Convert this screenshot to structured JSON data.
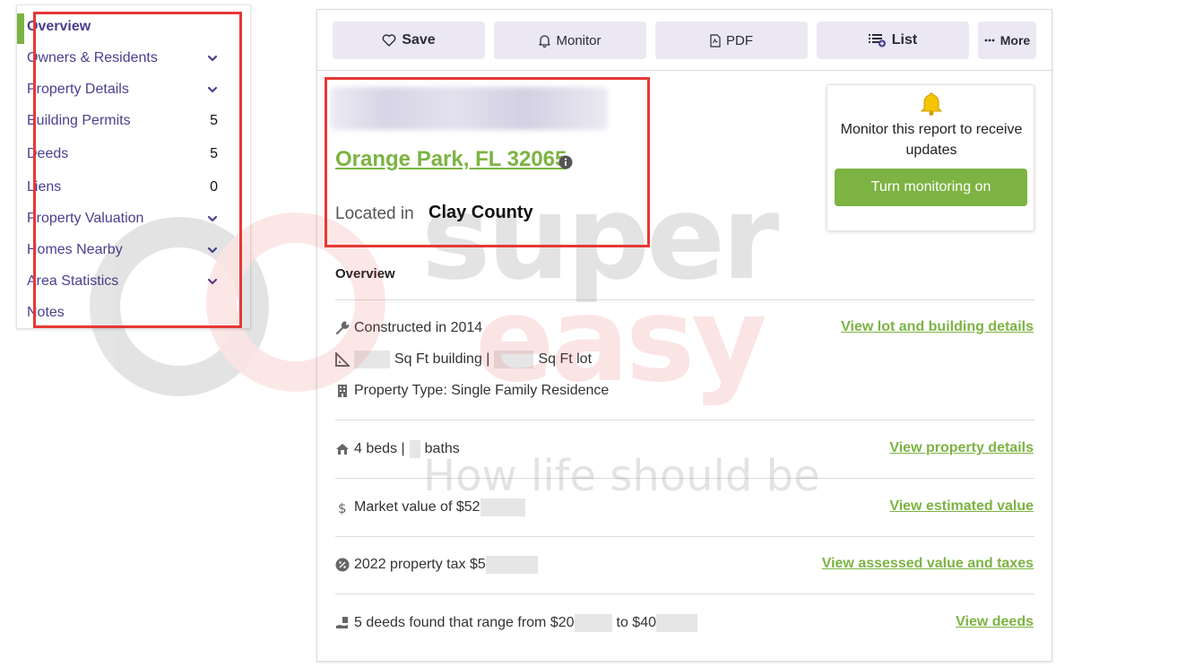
{
  "sidebar": {
    "items": [
      {
        "label": "Overview",
        "active": true
      },
      {
        "label": "Owners & Residents",
        "expandable": true
      },
      {
        "label": "Property Details",
        "expandable": true
      },
      {
        "label": "Building Permits",
        "count": "5"
      },
      {
        "label": "Deeds",
        "count": "5"
      },
      {
        "label": "Liens",
        "count": "0"
      },
      {
        "label": "Property Valuation",
        "expandable": true
      },
      {
        "label": "Homes Nearby",
        "expandable": true
      },
      {
        "label": "Area Statistics",
        "expandable": true
      },
      {
        "label": "Notes"
      }
    ]
  },
  "toolbar": {
    "save_label": "Save",
    "monitor_label": "Monitor",
    "pdf_label": "PDF",
    "list_label": "List",
    "more_label": "More"
  },
  "property": {
    "city_state_zip": "Orange Park, FL 32065",
    "located_in_label": "Located in",
    "county": "Clay County"
  },
  "monitor_card": {
    "text": "Monitor this report to receive updates",
    "button_label": "Turn monitoring on"
  },
  "overview": {
    "title": "Overview",
    "rows": {
      "constructed": "Constructed in 2014",
      "sqft_building": "Sq Ft building |",
      "sqft_lot": "Sq Ft lot",
      "property_type": "Property Type: Single Family Residence",
      "beds": "4 beds |",
      "baths": "baths",
      "market_value": "Market value of $52",
      "tax": "2022 property tax $5",
      "deeds_prefix": "5 deeds found that range from $20",
      "deeds_mid": "to $40"
    },
    "links": {
      "lot_building": "View lot and building details",
      "property_details": "View property details",
      "estimated_value": "View estimated value",
      "assessed_value": "View assessed value and taxes",
      "deeds": "View deeds"
    }
  },
  "watermark": {
    "brand_top": "super",
    "brand_bottom": "easy",
    "tagline": "How life should be"
  },
  "colors": {
    "accent_green": "#7cb342",
    "nav_purple": "#4a3f8f",
    "highlight_red": "#e53935",
    "button_bg": "#ebe8f3"
  }
}
